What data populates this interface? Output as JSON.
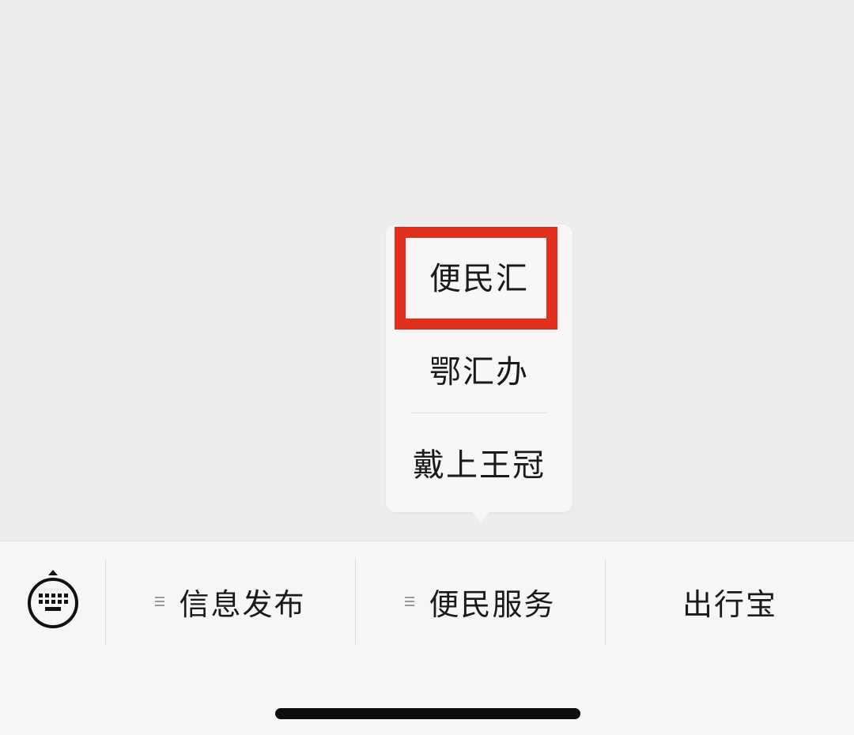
{
  "popup_menu": {
    "items": [
      {
        "label": "便民汇",
        "highlighted": true
      },
      {
        "label": "鄂汇办"
      },
      {
        "label": "戴上王冠"
      }
    ],
    "highlight_color": "#e2301c"
  },
  "menu_bar": {
    "keyboard_icon": "keyboard-icon",
    "tabs": [
      {
        "label": "信息发布",
        "has_submenu": true,
        "icon": "list-icon"
      },
      {
        "label": "便民服务",
        "has_submenu": true,
        "icon": "list-icon"
      },
      {
        "label": "出行宝",
        "has_submenu": false
      }
    ]
  },
  "colors": {
    "background": "#ededed",
    "menu_bar_background": "#f6f6f6",
    "popup_background": "#f7f7f7",
    "text": "#1a1a1a"
  }
}
